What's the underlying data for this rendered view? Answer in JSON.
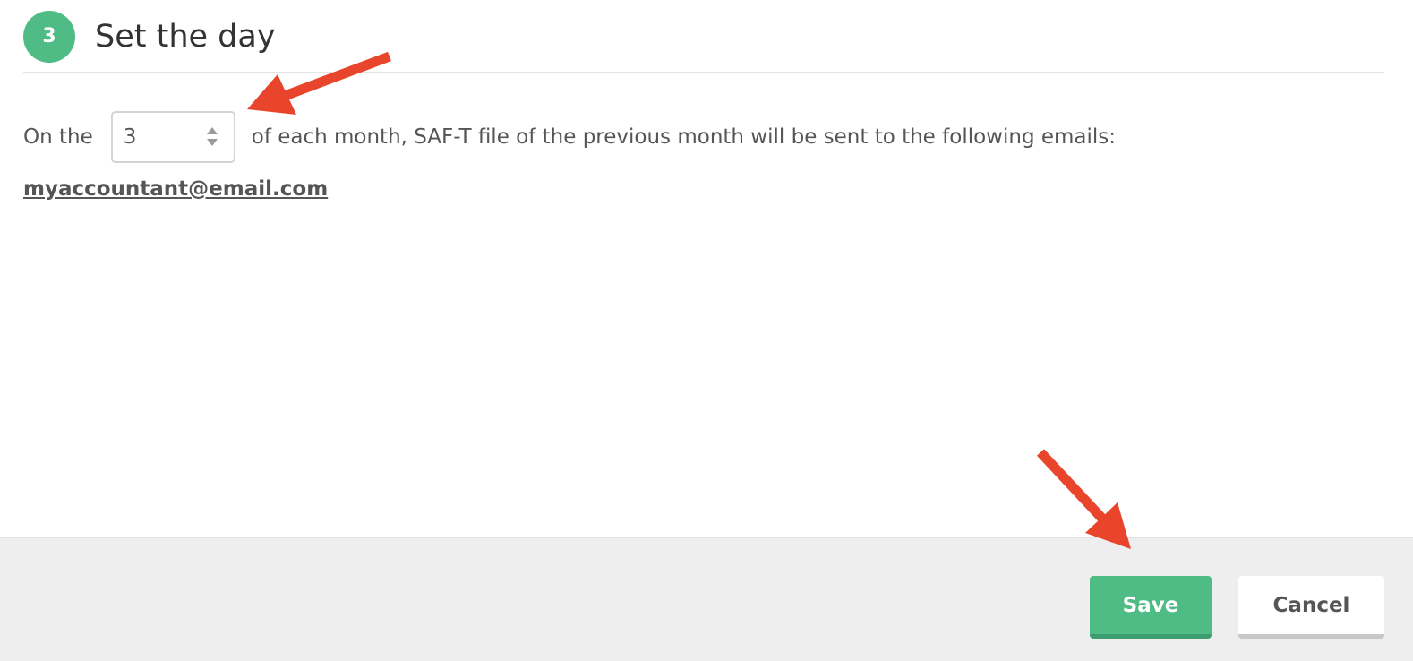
{
  "step": {
    "number": "3",
    "title": "Set the day"
  },
  "schedule": {
    "prefix": "On the",
    "day_value": "3",
    "suffix": "of each month, SAF-T file of the previous month will be sent to the following emails:"
  },
  "recipients": [
    "myaccountant@email.com"
  ],
  "footer": {
    "save_label": "Save",
    "cancel_label": "Cancel"
  },
  "colors": {
    "accent": "#4fbb85",
    "annotation_arrow": "#e8452c"
  }
}
